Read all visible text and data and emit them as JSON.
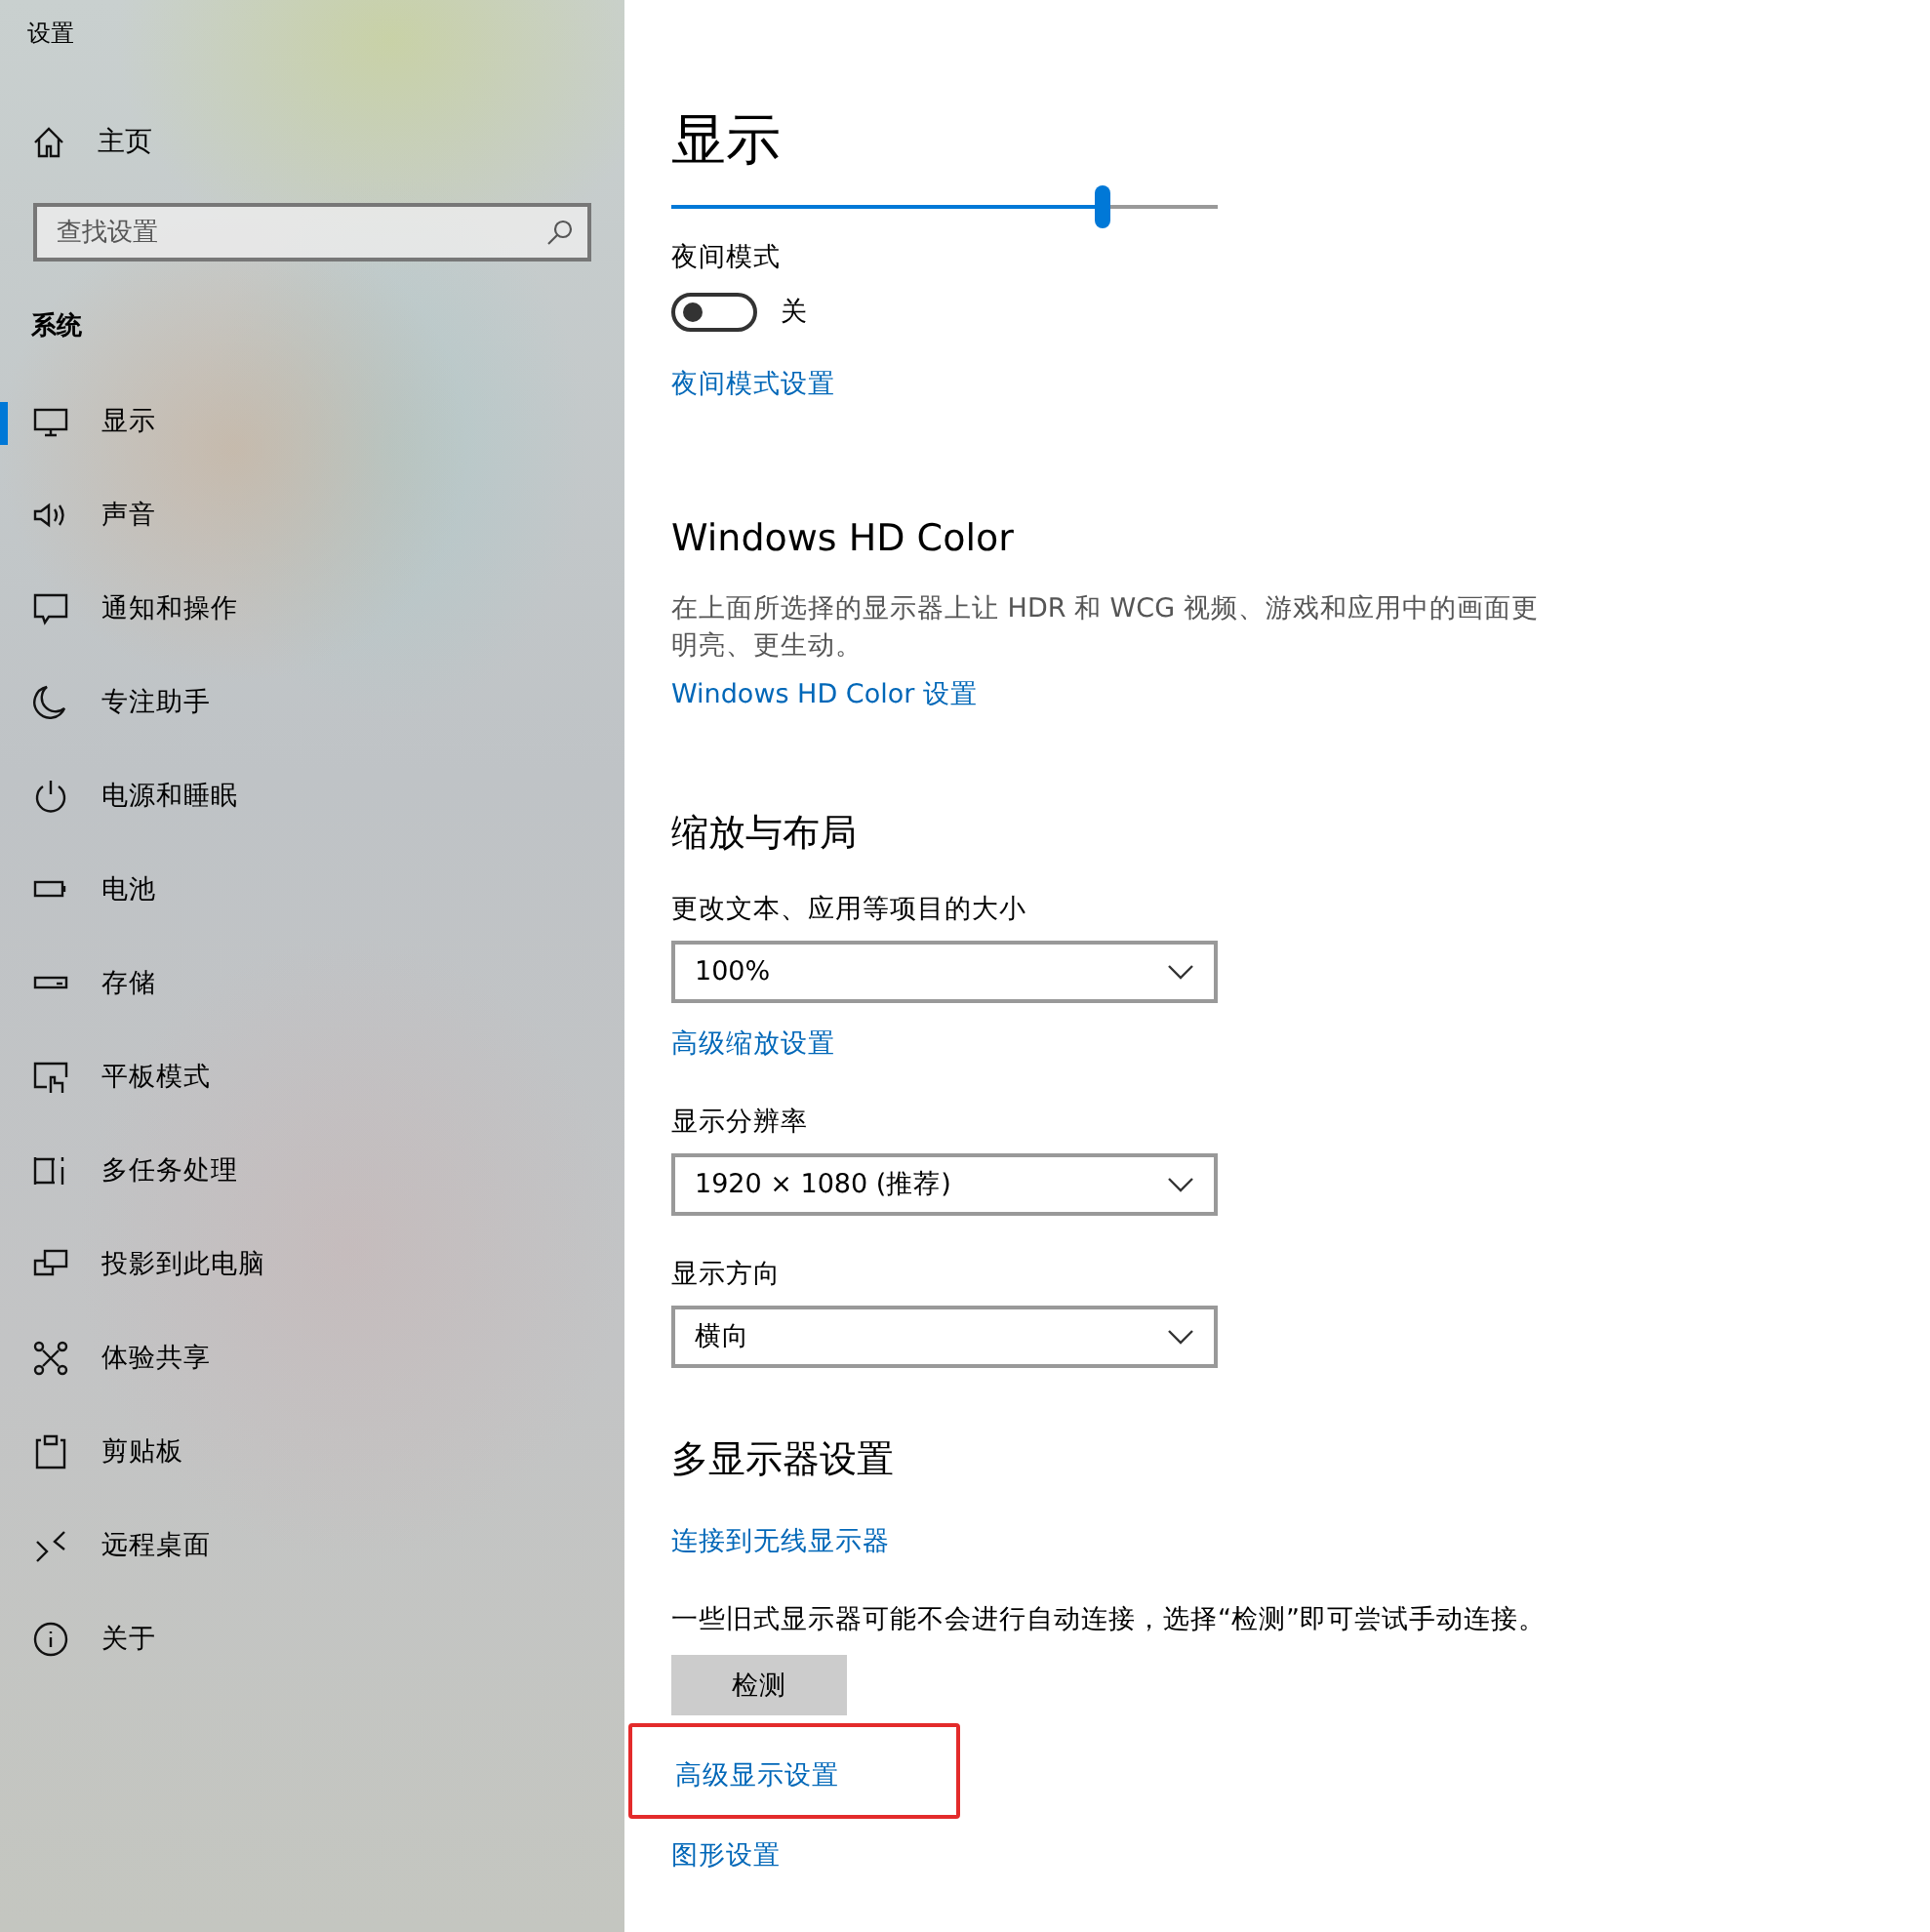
{
  "window": {
    "title": "设置"
  },
  "sidebar": {
    "home": {
      "label": "主页"
    },
    "search": {
      "placeholder": "查找设置"
    },
    "section": "系统",
    "items": [
      {
        "label": "显示",
        "selected": true
      },
      {
        "label": "声音",
        "selected": false
      },
      {
        "label": "通知和操作",
        "selected": false
      },
      {
        "label": "专注助手",
        "selected": false
      },
      {
        "label": "电源和睡眠",
        "selected": false
      },
      {
        "label": "电池",
        "selected": false
      },
      {
        "label": "存储",
        "selected": false
      },
      {
        "label": "平板模式",
        "selected": false
      },
      {
        "label": "多任务处理",
        "selected": false
      },
      {
        "label": "投影到此电脑",
        "selected": false
      },
      {
        "label": "体验共享",
        "selected": false
      },
      {
        "label": "剪贴板",
        "selected": false
      },
      {
        "label": "远程桌面",
        "selected": false
      },
      {
        "label": "关于",
        "selected": false
      }
    ]
  },
  "page": {
    "title": "显示",
    "brightness": {
      "level": 0.79
    },
    "night_mode": {
      "label": "夜间模式",
      "on": false,
      "state_text": "关",
      "link": "夜间模式设置"
    },
    "sections": [
      {
        "kind": "hdr",
        "heading": "Windows HD Color",
        "description": "在上面所选择的显示器上让 HDR 和 WCG 视频、游戏和应用中的画面更明亮、更生动。",
        "link": "Windows HD Color 设置"
      },
      {
        "kind": "scale",
        "heading": "缩放与布局",
        "fields": [
          {
            "label": "更改文本、应用等项目的大小",
            "value": "100%",
            "link": "高级缩放设置"
          },
          {
            "label": "显示分辨率",
            "value": "1920 × 1080 (推荐)"
          },
          {
            "label": "显示方向",
            "value": "横向"
          }
        ]
      },
      {
        "kind": "multi",
        "heading": "多显示器设置",
        "link": "连接到无线显示器",
        "description": "一些旧式显示器可能不会进行自动连接，选择“检测”即可尝试手动连接。",
        "button": "检测"
      }
    ],
    "footer_links": [
      {
        "label": "高级显示设置",
        "highlighted": true
      },
      {
        "label": "图形设置",
        "highlighted": false
      }
    ]
  }
}
